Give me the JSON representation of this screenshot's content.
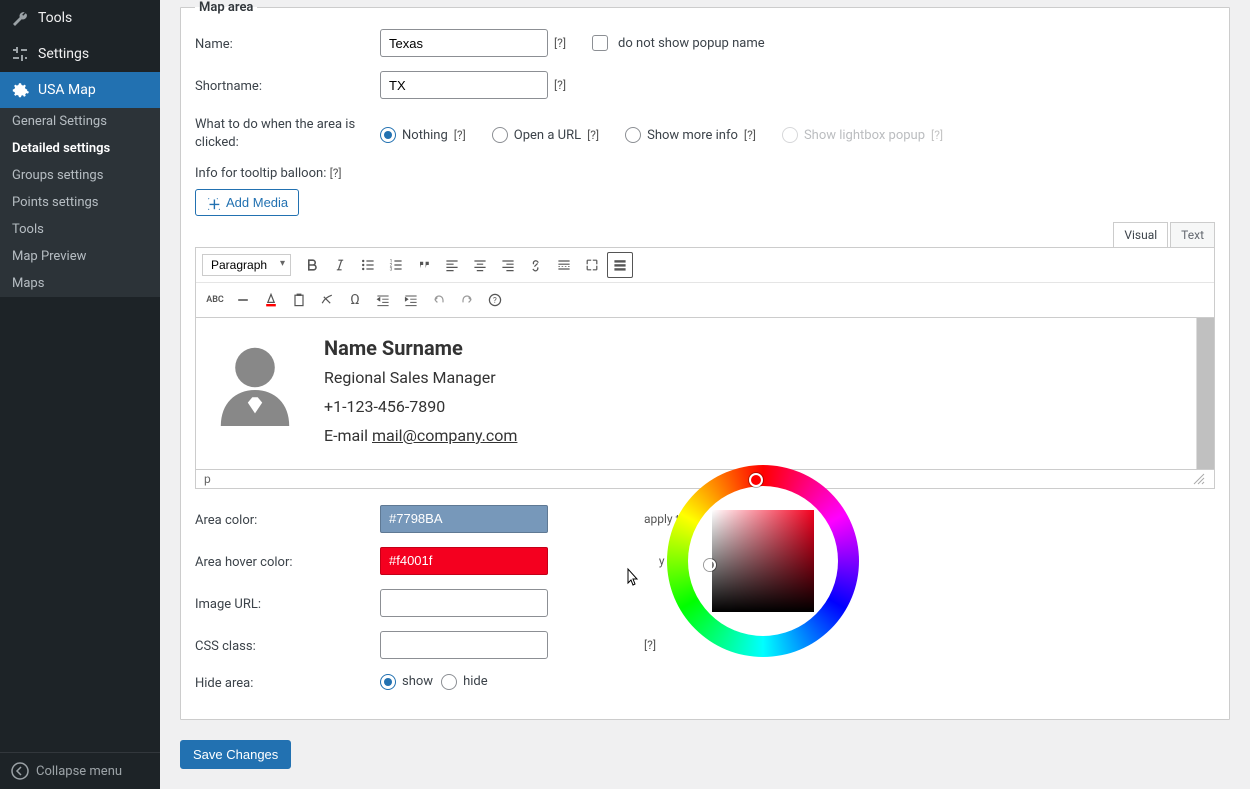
{
  "sidebar": {
    "items": [
      {
        "label": "Tools",
        "icon": "wrench-icon"
      },
      {
        "label": "Settings",
        "icon": "sliders-icon"
      },
      {
        "label": "USA Map",
        "icon": "gear-icon",
        "active": true
      }
    ],
    "sub_items": [
      "General Settings",
      "Detailed settings",
      "Groups settings",
      "Points settings",
      "Tools",
      "Map Preview",
      "Maps"
    ],
    "collapse": "Collapse menu"
  },
  "box_title": "Map area",
  "name": {
    "label": "Name:",
    "value": "Texas",
    "help": "[?]"
  },
  "no_popup": "do not show popup name",
  "shortname": {
    "label": "Shortname:",
    "value": "TX",
    "help": "[?]"
  },
  "click": {
    "label": "What to do when the area is clicked:",
    "options": [
      {
        "label": "Nothing",
        "help": "[?]",
        "checked": true
      },
      {
        "label": "Open a URL",
        "help": "[?]"
      },
      {
        "label": "Show more info",
        "help": "[?]"
      },
      {
        "label": "Show lightbox popup",
        "help": "[?]",
        "disabled": true
      }
    ]
  },
  "tooltip_label": "Info for tooltip balloon:",
  "tooltip_help": "[?]",
  "add_media": "Add Media",
  "editor": {
    "tabs": {
      "visual": "Visual",
      "text": "Text"
    },
    "para": "Paragraph",
    "status": "p",
    "person": {
      "name": "Name Surname",
      "title": "Regional Sales Manager",
      "phone": "+1-123-456-7890",
      "email_label": "E-mail ",
      "email": "mail@company.com"
    }
  },
  "area_color": {
    "label": "Area color:",
    "value": "#7798BA",
    "apply": "apply to all areas"
  },
  "hover_color": {
    "label": "Area hover color:",
    "value": "#f4001f",
    "apply": "apply to all areas"
  },
  "image_url": {
    "label": "Image URL:",
    "value": "",
    "help": ""
  },
  "css_class": {
    "label": "CSS class:",
    "value": "",
    "help": "[?]"
  },
  "hide": {
    "label": "Hide area:",
    "show": "show",
    "hide": "hide"
  },
  "save": "Save Changes"
}
